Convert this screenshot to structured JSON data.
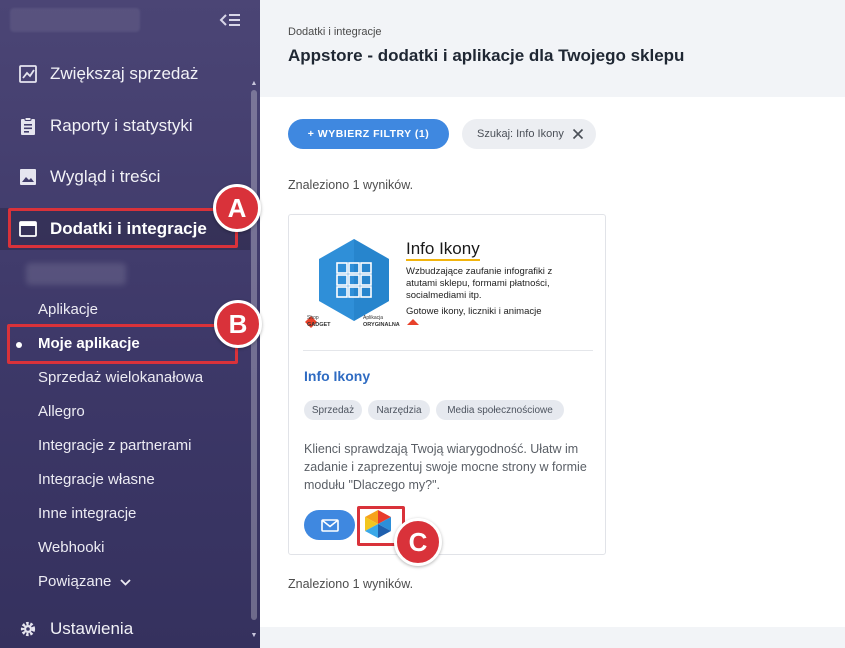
{
  "sidebar": {
    "main_items": [
      {
        "label": "Zwiększaj sprzedaż",
        "icon": "chart-icon"
      },
      {
        "label": "Raporty i statystyki",
        "icon": "clipboard-icon"
      },
      {
        "label": "Wygląd i treści",
        "icon": "image-icon"
      },
      {
        "label": "Dodatki i integracje",
        "icon": "window-icon"
      }
    ],
    "sub_items": [
      "Aplikacje",
      "Moje aplikacje",
      "Sprzedaż wielokanałowa",
      "Allegro",
      "Integracje z partnerami",
      "Integracje własne",
      "Inne integracje",
      "Webhooki",
      "Powiązane"
    ],
    "active_main": "Dodatki i integracje",
    "active_sub": "Moje aplikacje",
    "settings_label": "Ustawienia"
  },
  "header": {
    "breadcrumb": "Dodatki i integracje",
    "title": "Appstore - dodatki i aplikacje dla Twojego sklepu"
  },
  "toolbar": {
    "filter_label": "+ WYBIERZ FILTRY (1)",
    "search_chip": "Szukaj: Info Ikony"
  },
  "results": {
    "count_top": "Znaleziono 1 wyników.",
    "count_bottom": "Znaleziono 1 wyników."
  },
  "app_card": {
    "banner": {
      "title": "Info Ikony",
      "bullets": [
        "Wzbudzające zaufanie infografiki z atutami sklepu, formami płatności, socialmediami itp.",
        "Gotowe ikony, liczniki i animacje"
      ],
      "brand": "Shop GADGET",
      "brand_prefix": "Shop",
      "brand_name": "GADGET",
      "certificate": "Aplikacja ORYGINALNA",
      "certificate_line1": "Aplikacja",
      "certificate_line2": "ORYGINALNA"
    },
    "name": "Info Ikony",
    "tags": [
      "Sprzedaż",
      "Narzędzia",
      "Media społecznościowe"
    ],
    "description": "Klienci sprawdzają Twoją wiarygodność. Ułatw im zadanie i zaprezentuj swoje mocne strony w formie modułu \"Dlaczego my?\"."
  },
  "annotations": {
    "a": "A",
    "b": "B",
    "c": "C"
  },
  "colors": {
    "sidebar": "#3d3868",
    "accent": "#3f88e0",
    "highlight": "#d9323a",
    "link": "#2e6bc2"
  }
}
